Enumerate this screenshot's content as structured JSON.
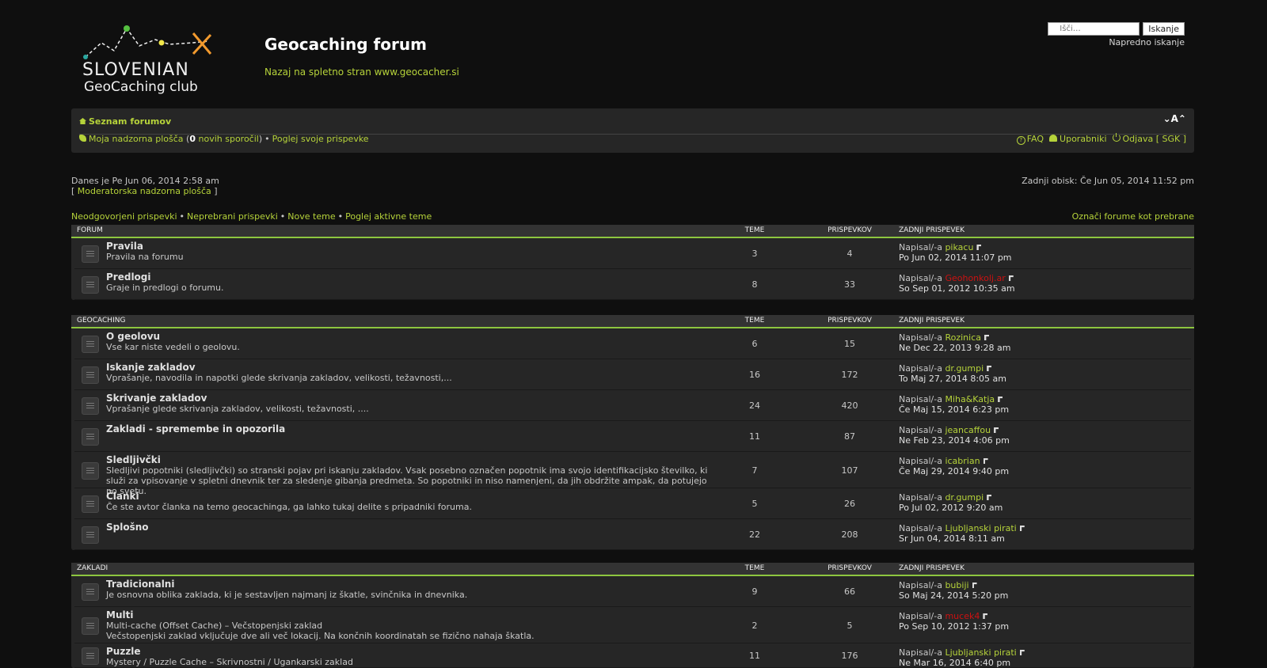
{
  "header": {
    "logo_line1": "SLOVENIAN",
    "logo_line2": "GeoCaching club",
    "site_title": "Geocaching forum",
    "site_desc": "Nazaj na spletno stran www.geocacher.si",
    "search_placeholder": "Išči…",
    "search_button": "Iskanje",
    "advanced_search": "Napredno iskanje"
  },
  "navbar": {
    "breadcrumb": "Seznam forumov",
    "font_size_toggle": "⌄A⌃",
    "ucp_link": "Moja nadzorna plošča",
    "ucp_new_open": " (",
    "ucp_new_count": "0",
    "ucp_new_label": " novih sporočil",
    "ucp_new_close": ")",
    "own_posts": "Poglej svoje prispevke",
    "faq": "FAQ",
    "members": "Uporabniki",
    "logout": "Odjava [ SGK ]"
  },
  "info": {
    "current_time": "Danes je Pe Jun 06, 2014 2:58 am",
    "mcp_open": "[ ",
    "mcp_link": "Moderatorska nadzorna plošča",
    "mcp_close": " ]",
    "last_visit": "Zadnji obisk: Če Jun 05, 2014 11:52 pm"
  },
  "actions": {
    "unanswered": "Neodgovorjeni prispevki",
    "unread": "Neprebrani prispevki",
    "new_topics": "Nove teme",
    "active_topics": "Poglej aktivne teme",
    "mark_read": "Označi forume kot prebrane"
  },
  "columns": {
    "topics": "TEME",
    "posts": "PRISPEVKOV",
    "last_post": "ZADNJI PRISPEVEK",
    "by": "Napisal/-a "
  },
  "categories": [
    {
      "name": "FORUM",
      "forums": [
        {
          "title": "Pravila",
          "desc": "Pravila na forumu",
          "topics": "3",
          "posts": "4",
          "user": "pikacu",
          "date": "Po Jun 02, 2014 11:07 pm"
        },
        {
          "title": "Predlogi",
          "desc": "Graje in predlogi o forumu.",
          "topics": "8",
          "posts": "33",
          "user": "Geohonkolj.ar",
          "date": "So Sep 01, 2012 10:35 am"
        }
      ]
    },
    {
      "name": "GEOCACHING",
      "forums": [
        {
          "title": "O geolovu",
          "desc": "Vse kar niste vedeli o geolovu.",
          "topics": "6",
          "posts": "15",
          "user": "Rozinica",
          "date": "Ne Dec 22, 2013 9:28 am"
        },
        {
          "title": "Iskanje zakladov",
          "desc": "Vprašanje, navodila in napotki glede skrivanja zakladov, velikosti, težavnosti,...",
          "topics": "16",
          "posts": "172",
          "user": "dr.gumpi",
          "date": "To Maj 27, 2014 8:05 am"
        },
        {
          "title": "Skrivanje zakladov",
          "desc": "Vprašanje glede skrivanja zakladov, velikosti, težavnosti, ....",
          "topics": "24",
          "posts": "420",
          "user": "Miha&Katja",
          "date": "Če Maj 15, 2014 6:23 pm"
        },
        {
          "title": "Zakladi - spremembe in opozorila",
          "desc": "",
          "topics": "11",
          "posts": "87",
          "user": "jeancaffou",
          "date": "Ne Feb 23, 2014 4:06 pm"
        },
        {
          "title": "Sledljivčki",
          "desc": "Sledljivi popotniki (sledljivčki) so stranski pojav pri iskanju zakladov. Vsak posebno označen popotnik ima svojo identifikacijsko številko, ki služi za vpisovanje v spletni dnevnik ter za sledenje gibanja predmeta. So popotniki in niso namenjeni, da jih obdržite ampak, da potujejo po svetu.",
          "topics": "7",
          "posts": "107",
          "user": "icabrian",
          "date": "Če Maj 29, 2014 9:40 pm"
        },
        {
          "title": "Članki",
          "desc": "Če ste avtor članka na temo geocachinga, ga lahko tukaj delite s pripadniki foruma.",
          "topics": "5",
          "posts": "26",
          "user": "dr.gumpi",
          "date": "Po Jul 02, 2012 9:20 am"
        },
        {
          "title": "Splošno",
          "desc": "",
          "topics": "22",
          "posts": "208",
          "user": "Ljubljanski pirati",
          "date": "Sr Jun 04, 2014 8:11 am"
        }
      ]
    },
    {
      "name": "ZAKLADI",
      "forums": [
        {
          "title": "Tradicionalni",
          "desc": "Je osnovna oblika zaklada, ki je sestavljen najmanj iz škatle, svinčnika in dnevnika.",
          "topics": "9",
          "posts": "66",
          "user": "bubiji",
          "date": "So Maj 24, 2014 5:20 pm"
        },
        {
          "title": "Multi",
          "desc": "Multi-cache (Offset Cache) – Večstopenjski zaklad",
          "desc2": "Večstopenjski zaklad vključuje dve ali več lokacij. Na končnih koordinatah se fizično nahaja škatla.",
          "topics": "2",
          "posts": "5",
          "user": "mucek4",
          "date": "Po Sep 10, 2012 1:37 pm"
        },
        {
          "title": "Puzzle",
          "desc": "Mystery / Puzzle Cache – Skrivnostni / Ugankarski zaklad",
          "topics": "11",
          "posts": "176",
          "user": "Ljubljanski pirati",
          "date": "Ne Mar 16, 2014 6:40 pm"
        }
      ]
    }
  ],
  "colors": {
    "accent": "#b6d33a",
    "rule": "#8dc63f",
    "red_user": "#cc1111"
  }
}
